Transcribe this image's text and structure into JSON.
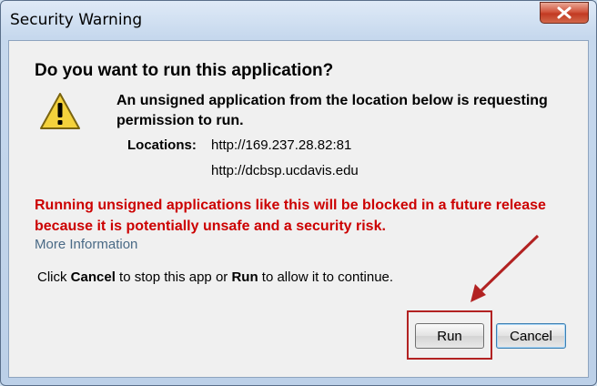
{
  "window": {
    "title": "Security Warning"
  },
  "dialog": {
    "heading": "Do you want to run this application?",
    "message": "An unsigned application from the location below is requesting permission to run.",
    "locations_label": "Locations:",
    "locations": [
      "http://169.237.28.82:81",
      "http://dcbsp.ucdavis.edu"
    ],
    "warning_text": "Running unsigned applications like this will be blocked in a future release because it is potentially unsafe and a security risk.",
    "more_info_link": "More Information",
    "instruction": {
      "part1": "Click ",
      "cancel_word": "Cancel",
      "part2": " to stop this app or ",
      "run_word": "Run",
      "part3": " to allow it to continue."
    }
  },
  "buttons": {
    "run_label": "Run",
    "cancel_label": "Cancel"
  },
  "icons": {
    "close": "close-icon",
    "warning": "warning-icon"
  },
  "colors": {
    "warning_text": "#cc0000",
    "annotation": "#b22222",
    "link": "#4a6a86"
  }
}
